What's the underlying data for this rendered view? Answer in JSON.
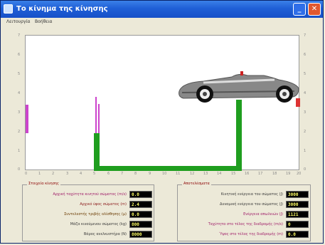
{
  "window": {
    "title": "Το κίνημα της κίνησης",
    "icon": "app-icon"
  },
  "menubar": {
    "items": [
      "Λειτουργία",
      "Βοήθεια"
    ]
  },
  "chart": {
    "y_ticks": [
      "7",
      "6",
      "5",
      "4",
      "3",
      "2",
      "1",
      "0"
    ],
    "x_ticks": [
      "0",
      "1",
      "2",
      "3",
      "4",
      "5",
      "6",
      "7",
      "8",
      "9",
      "10",
      "11",
      "12",
      "13",
      "14",
      "15",
      "16",
      "17",
      "18",
      "19",
      "20"
    ],
    "colors": {
      "track": "#1f9e1f",
      "marker_left": "#cc44cc",
      "marker_right": "#dd3333",
      "car_body": "#888888"
    }
  },
  "left_panel": {
    "title": "Στοιχεία κίνησης",
    "rows": [
      {
        "label": "Αρχική ταχύτητα κινητού σώματος (m/s)",
        "value": "0.0"
      },
      {
        "label": "Αρχικό ύψος σώματος (m)",
        "value": "2.4"
      },
      {
        "label": "Συντελεστής τριβής ολίσθησης (μ)",
        "value": "0.0"
      },
      {
        "label": "Μάζα κινούμενου σώματος (kg)",
        "value": "800"
      },
      {
        "label": "Βάρος ανελκυστήρα (N)",
        "value": "8000"
      }
    ]
  },
  "right_panel": {
    "title": "Αποτελέσματα",
    "rows": [
      {
        "label": "Κινητική ενέργεια του σώματος (J)",
        "value": "3000"
      },
      {
        "label": "Δυναμική ενέργεια του σώματος (J)",
        "value": "3000"
      },
      {
        "label": "Ενέργεια απωλειών (J)",
        "value": "1121"
      },
      {
        "label": "Ταχύτητα στο τέλος της διαδρομής (m/s)",
        "value": "0"
      },
      {
        "label": "Ύψος στο τέλος της διαδρομής (m)",
        "value": "0.0"
      }
    ]
  }
}
